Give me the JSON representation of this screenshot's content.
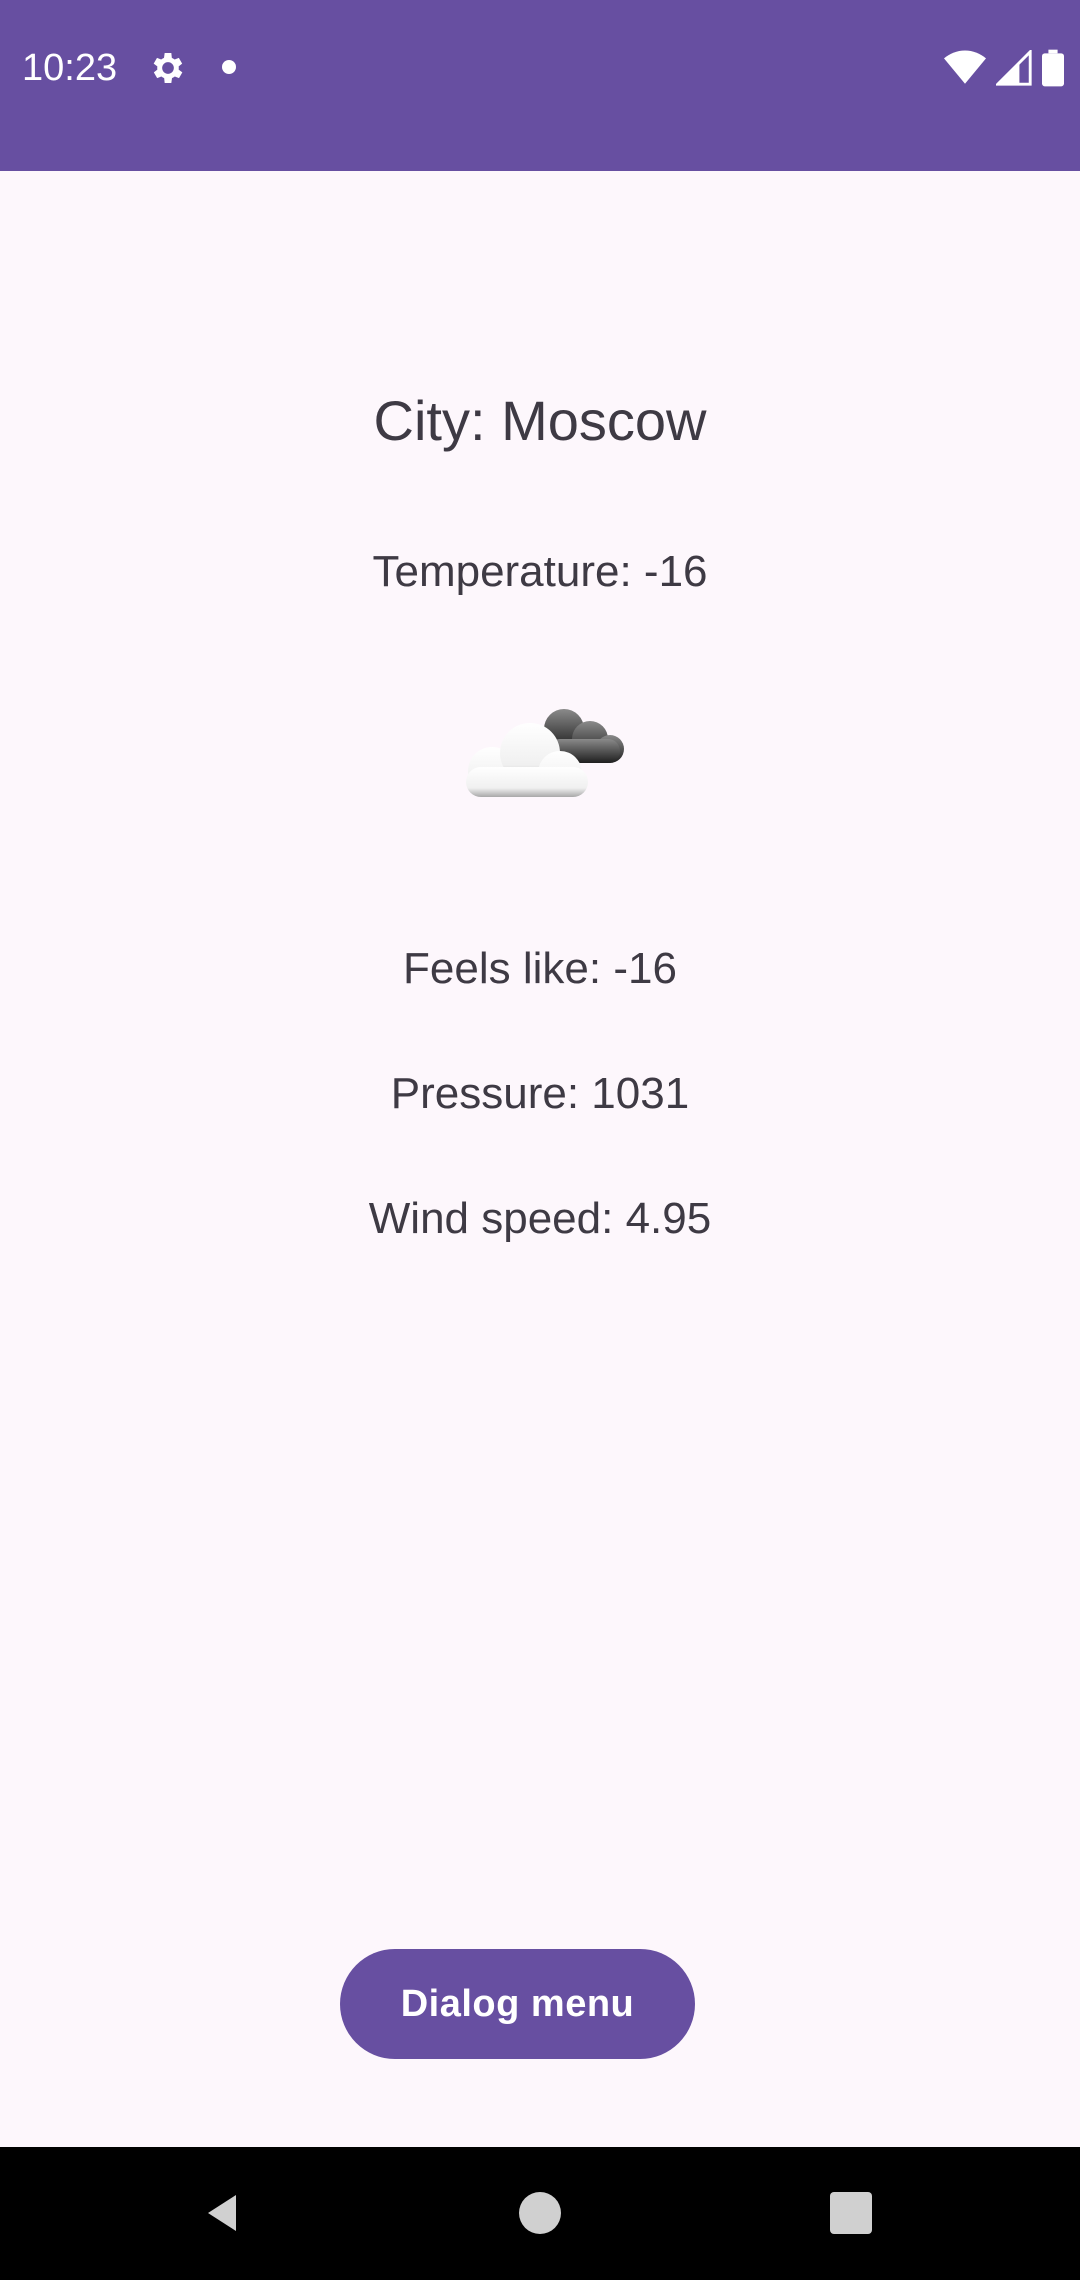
{
  "status_bar": {
    "time": "10:23",
    "icons": [
      "gear-icon",
      "notification-dot-icon",
      "wifi-icon",
      "signal-icon",
      "battery-icon"
    ],
    "background": "#674FA1"
  },
  "weather": {
    "city": "City: Moscow",
    "temperature": "Temperature: -16",
    "icon": "cloudy-icon",
    "feels_like": "Feels like: -16",
    "pressure": "Pressure: 1031",
    "wind_speed": "Wind speed: 4.95"
  },
  "actions": {
    "dialog_menu_label": "Dialog menu"
  },
  "navigation": {
    "icons": [
      "back-icon",
      "home-icon",
      "recents-icon"
    ]
  },
  "colors": {
    "accent": "#674FA1",
    "background": "#FDF7FC",
    "text": "#3E3A44"
  }
}
